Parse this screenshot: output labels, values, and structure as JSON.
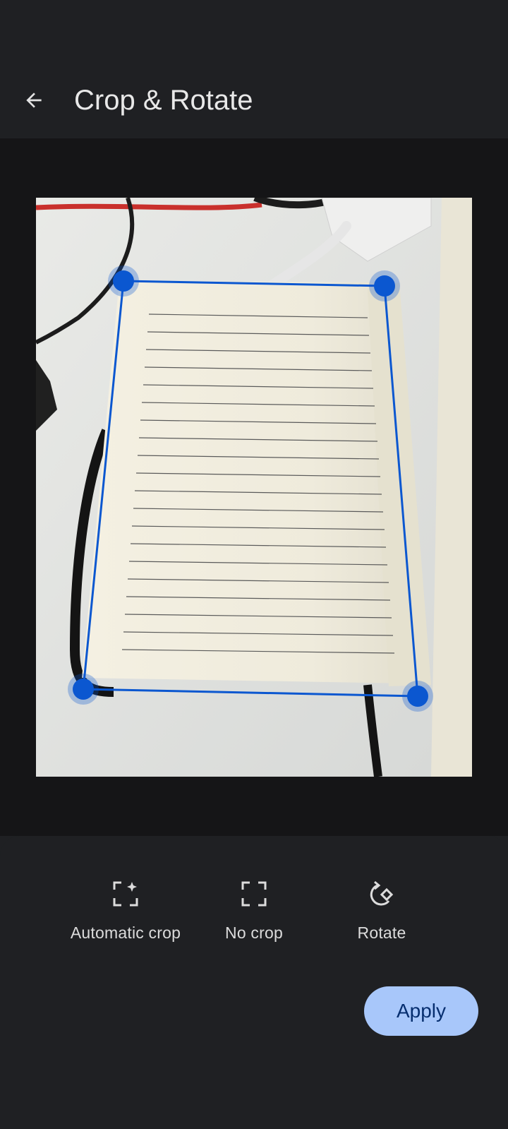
{
  "app_bar": {
    "title": "Crop & Rotate",
    "back_icon": "arrow-back-icon"
  },
  "crop": {
    "accent_color": "#0b57d0",
    "handle_color": "#0b57d0"
  },
  "tools": [
    {
      "label": "Automatic crop",
      "icon": "auto-crop-icon"
    },
    {
      "label": "No crop",
      "icon": "no-crop-icon"
    },
    {
      "label": "Rotate",
      "icon": "rotate-icon"
    }
  ],
  "apply": {
    "label": "Apply",
    "color": "#a8c7fa"
  }
}
